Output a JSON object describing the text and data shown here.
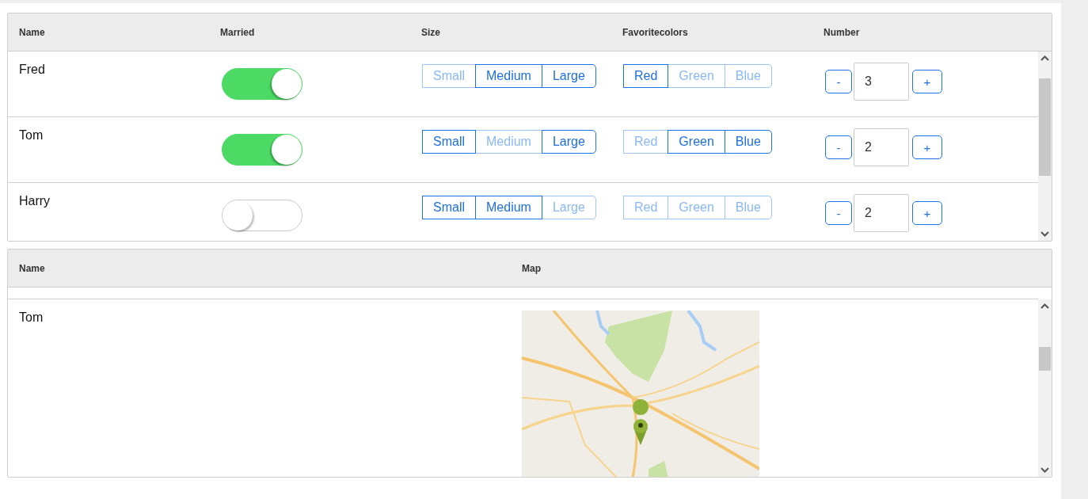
{
  "grids": [
    {
      "columns": [
        "Name",
        "Married",
        "Size",
        "Favoritecolors",
        "Number"
      ],
      "rows": [
        {
          "cells": [
            {
              "kind": "text",
              "text": "Fred"
            },
            {
              "kind": "switch",
              "on": true
            },
            {
              "kind": "segments",
              "options": [
                {
                  "label": "Small",
                  "selected": false
                },
                {
                  "label": "Medium",
                  "selected": true
                },
                {
                  "label": "Large",
                  "selected": true
                }
              ]
            },
            {
              "kind": "segments",
              "options": [
                {
                  "label": "Red",
                  "selected": true
                },
                {
                  "label": "Green",
                  "selected": false
                },
                {
                  "label": "Blue",
                  "selected": false
                }
              ]
            },
            {
              "kind": "stepper",
              "minus": "-",
              "value": "3",
              "plus": "+"
            }
          ]
        },
        {
          "cells": [
            {
              "kind": "text",
              "text": "Tom"
            },
            {
              "kind": "switch",
              "on": true
            },
            {
              "kind": "segments",
              "options": [
                {
                  "label": "Small",
                  "selected": true
                },
                {
                  "label": "Medium",
                  "selected": false
                },
                {
                  "label": "Large",
                  "selected": true
                }
              ]
            },
            {
              "kind": "segments",
              "options": [
                {
                  "label": "Red",
                  "selected": false
                },
                {
                  "label": "Green",
                  "selected": true
                },
                {
                  "label": "Blue",
                  "selected": true
                }
              ]
            },
            {
              "kind": "stepper",
              "minus": "-",
              "value": "2",
              "plus": "+"
            }
          ]
        },
        {
          "cells": [
            {
              "kind": "text",
              "text": "Harry"
            },
            {
              "kind": "switch",
              "on": false
            },
            {
              "kind": "segments",
              "options": [
                {
                  "label": "Small",
                  "selected": true
                },
                {
                  "label": "Medium",
                  "selected": true
                },
                {
                  "label": "Large",
                  "selected": false
                }
              ]
            },
            {
              "kind": "segments",
              "options": [
                {
                  "label": "Red",
                  "selected": false
                },
                {
                  "label": "Green",
                  "selected": false
                },
                {
                  "label": "Blue",
                  "selected": false
                }
              ]
            },
            {
              "kind": "stepper",
              "minus": "-",
              "value": "2",
              "plus": "+"
            }
          ]
        }
      ]
    },
    {
      "columns": [
        "Name",
        "Map"
      ],
      "rows": [
        {
          "cells": [
            {
              "kind": "text",
              "text": "Tom"
            },
            {
              "kind": "picture"
            }
          ]
        }
      ]
    }
  ]
}
